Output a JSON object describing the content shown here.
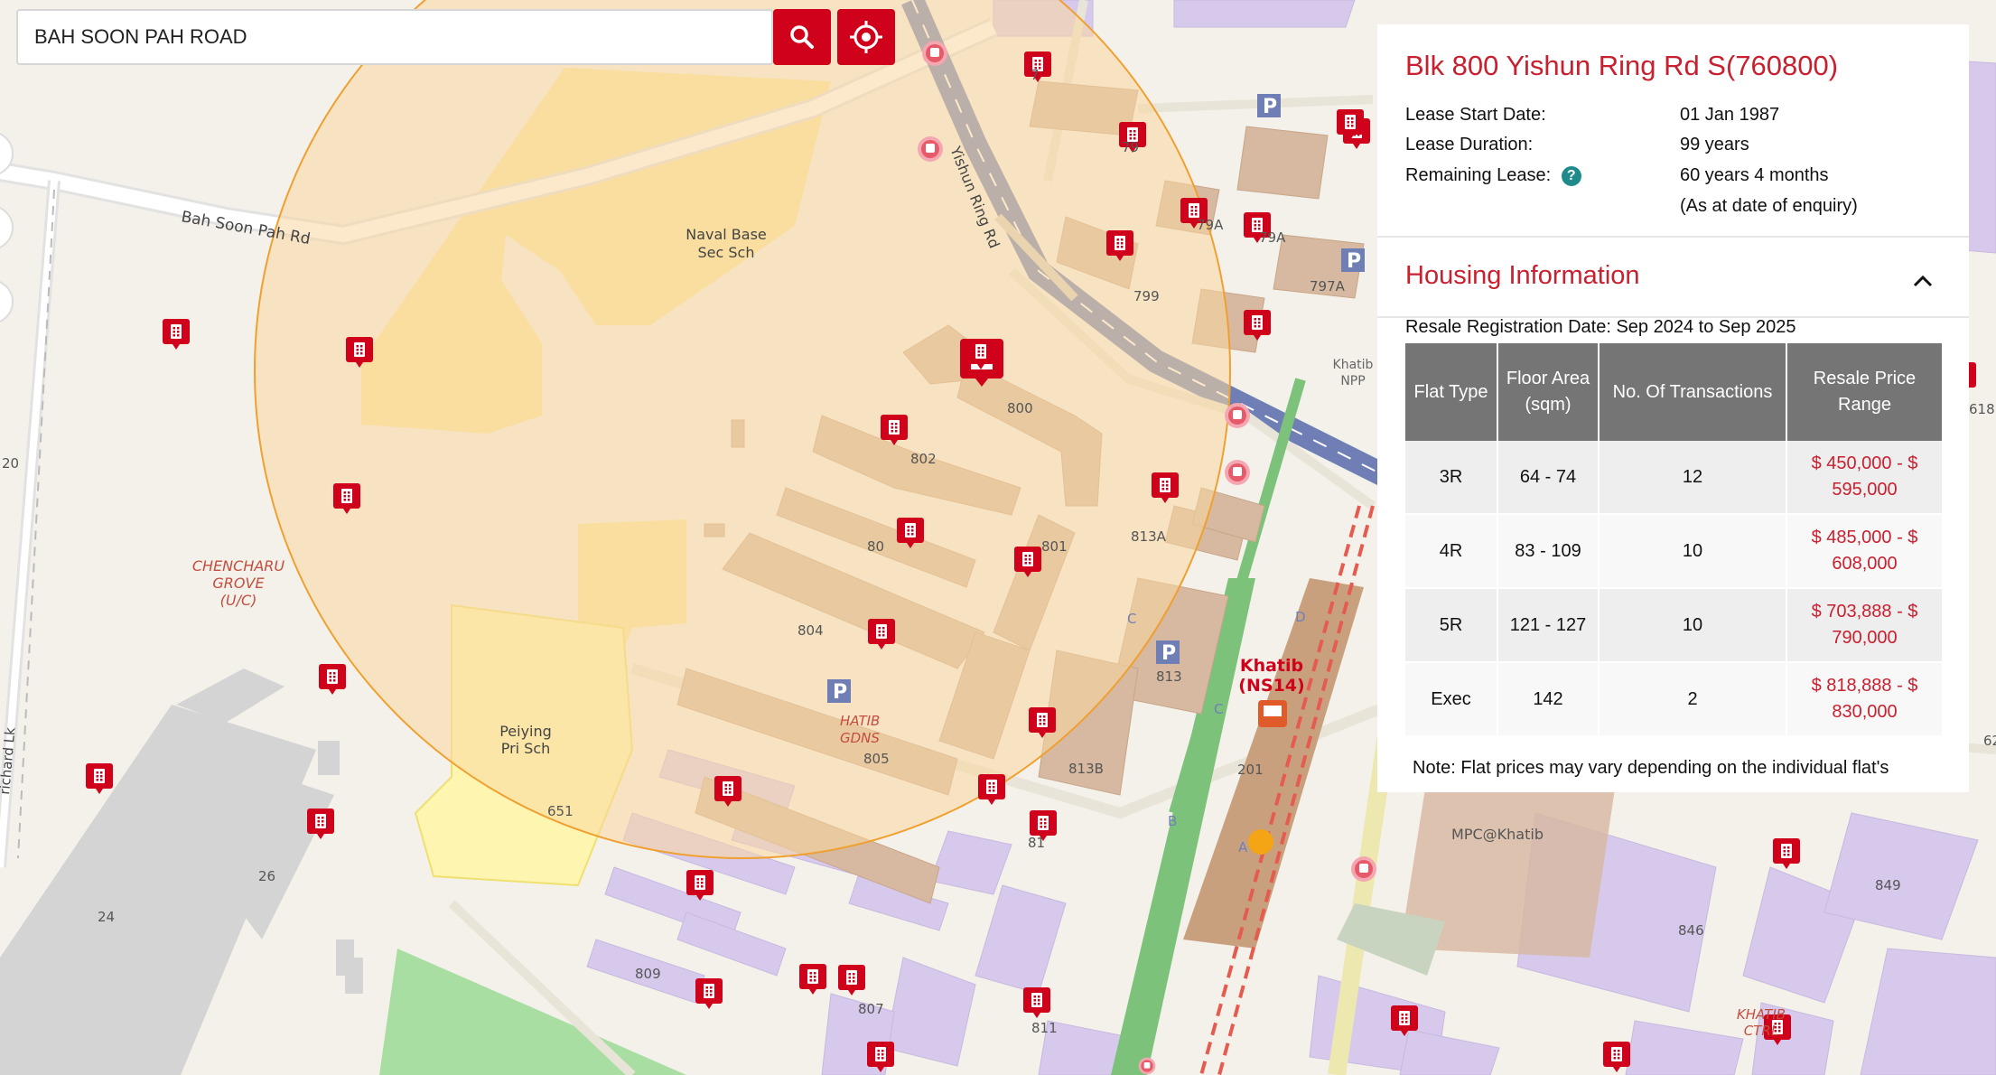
{
  "search": {
    "value": "BAH SOON PAH ROAD",
    "search_button_icon": "search-icon",
    "locate_button_icon": "crosshair-icon"
  },
  "map": {
    "colors": {
      "land": "#f4f1ea",
      "building_residential": "#d7c9ec",
      "school": "#f9e79f",
      "park": "#a8dea1",
      "road_major": "#6f7fb5",
      "rail": "#e55b50",
      "radius_fill": "#fad7a0",
      "radius_stroke": "#f0a030",
      "marker": "#d0021b"
    },
    "labels": {
      "road_bah_soon_pah": "Bah Soon Pah Rd",
      "road_yishun_ring": "Yishun Ring Rd",
      "naval_base": "Naval Base\nSec Sch",
      "chencharu": "CHENCHARU\nGROVE\n(U/C)",
      "peiying": "Peiying\nPri Sch",
      "khatib_station": "Khatib\n(NS14)",
      "khatib_gdns": "HATIB\nGDNS",
      "khatib_npp": "Khatib\nNPP",
      "mpc": "MPC@Khatib",
      "khatib_ctrl": "KHATIB\nCTRL",
      "blocks": [
        "800",
        "801",
        "802",
        "804",
        "805",
        "799",
        "813",
        "813A",
        "813B",
        "797A",
        "651",
        "26",
        "24",
        "809",
        "846",
        "849",
        "201",
        "20",
        "7",
        "79",
        "79A",
        "80",
        "807",
        "81",
        "811",
        "618",
        "62"
      ],
      "misc": [
        "P",
        "C",
        "D",
        "B",
        "A",
        "richard Lk"
      ]
    }
  },
  "panel": {
    "title": "Blk 800 Yishun Ring Rd S(760800)",
    "lease_start_label": "Lease Start Date:",
    "lease_start_value": "01 Jan 1987",
    "lease_duration_label": "Lease Duration:",
    "lease_duration_value": "99 years",
    "remaining_label": "Remaining Lease:",
    "remaining_value": "60 years 4 months",
    "remaining_note": "(As at date of enquiry)",
    "help_icon": "?",
    "housing_title": "Housing Information",
    "resale_date": "Resale Registration Date: Sep 2024 to Sep 2025",
    "table": {
      "headers": [
        "Flat Type",
        "Floor Area (sqm)",
        "No. Of Transactions",
        "Resale Price Range"
      ],
      "rows": [
        {
          "type": "3R",
          "area": "64 - 74",
          "tx": "12",
          "price": "$ 450,000 - $ 595,000"
        },
        {
          "type": "4R",
          "area": "83 - 109",
          "tx": "10",
          "price": "$ 485,000 - $ 608,000"
        },
        {
          "type": "5R",
          "area": "121 - 127",
          "tx": "10",
          "price": "$ 703,888 - $ 790,000"
        },
        {
          "type": "Exec",
          "area": "142",
          "tx": "2",
          "price": "$ 818,888 - $ 830,000"
        }
      ]
    },
    "note": "Note: Flat prices may vary depending on the individual flat's"
  }
}
